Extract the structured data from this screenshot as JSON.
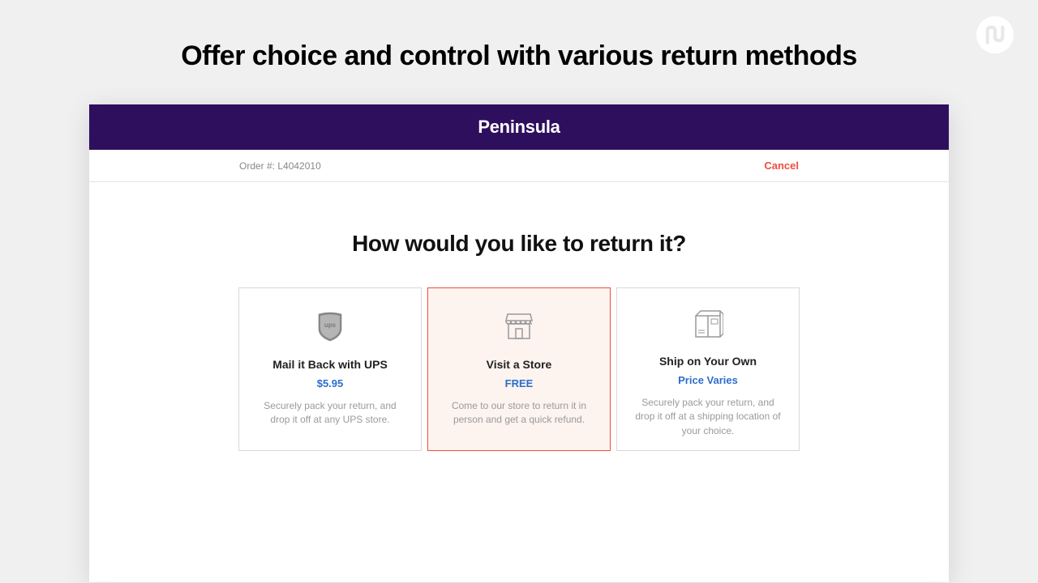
{
  "page": {
    "heading": "Offer choice and control with various return methods"
  },
  "app": {
    "brand": "Peninsula",
    "order_label": "Order #: L4042010",
    "cancel_label": "Cancel",
    "question": "How would you like to return it?"
  },
  "options": [
    {
      "title": "Mail it Back with UPS",
      "price": "$5.95",
      "desc": "Securely pack your return, and drop it off at any UPS store."
    },
    {
      "title": "Visit a Store",
      "price": "FREE",
      "desc": "Come to our store to return it in person and get a quick refund."
    },
    {
      "title": "Ship on Your Own",
      "price": "Price Varies",
      "desc": "Securely pack your return, and drop it off at a shipping location of your choice."
    }
  ]
}
